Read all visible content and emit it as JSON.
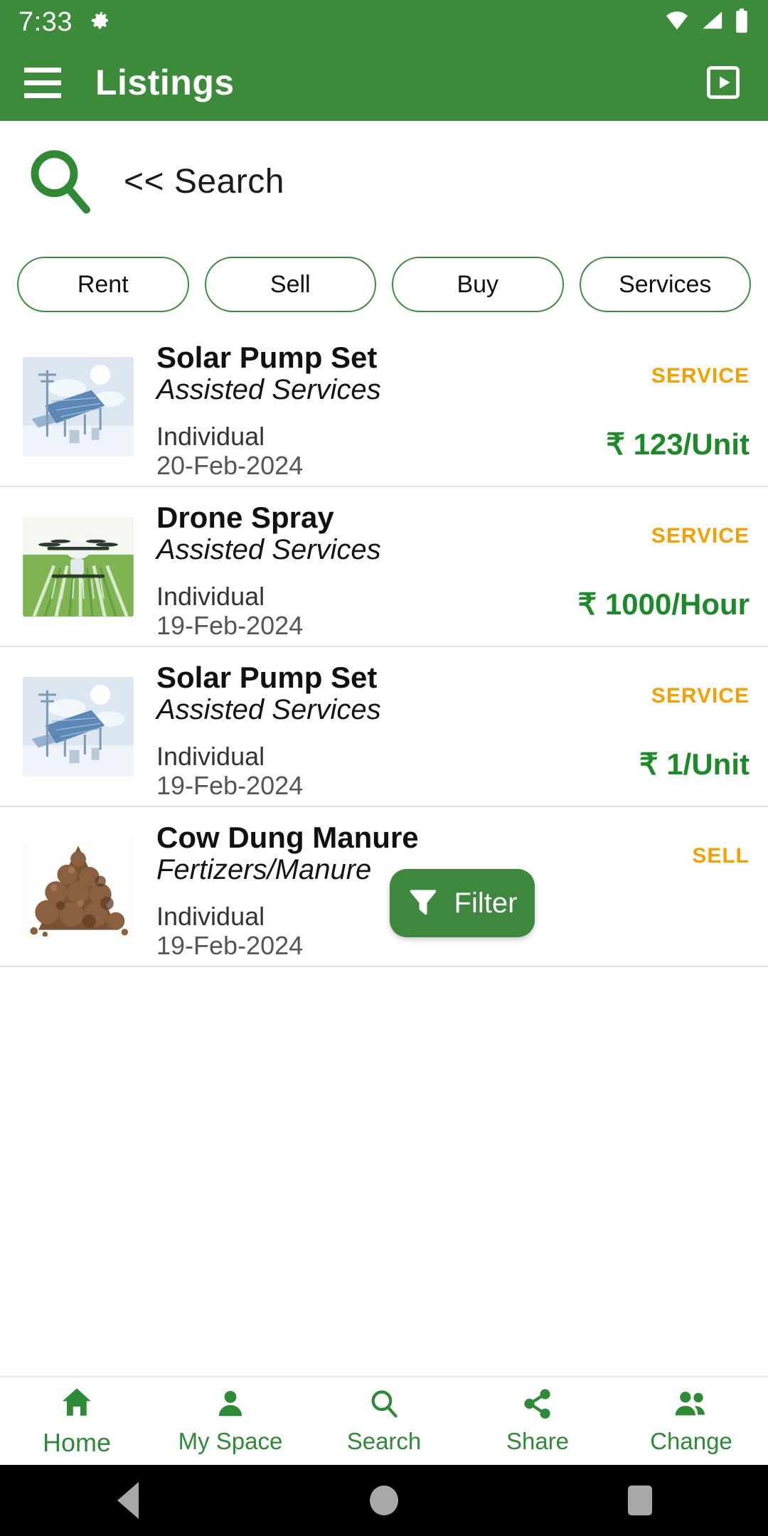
{
  "status_bar": {
    "time": "7:33",
    "gear_icon": "gear-icon",
    "wifi_icon": "wifi-icon",
    "signal_icon": "cellular-signal-icon",
    "battery_icon": "battery-icon"
  },
  "app_bar": {
    "menu_icon": "hamburger-menu-icon",
    "title": "Listings",
    "action_icon": "cast-screen-icon"
  },
  "search": {
    "icon": "search-icon",
    "label": "<< Search"
  },
  "chips": [
    {
      "label": "Rent"
    },
    {
      "label": "Sell"
    },
    {
      "label": "Buy"
    },
    {
      "label": "Services"
    }
  ],
  "listings": [
    {
      "title": "Solar Pump Set",
      "category": "Assisted Services",
      "badge": "SERVICE",
      "owner": "Individual",
      "date": "20-Feb-2024",
      "price": "₹ 123/Unit",
      "thumb": "solar-panel-thumbnail"
    },
    {
      "title": "Drone Spray",
      "category": "Assisted Services",
      "badge": "SERVICE",
      "owner": "Individual",
      "date": "19-Feb-2024",
      "price": "₹ 1000/Hour",
      "thumb": "drone-spray-thumbnail"
    },
    {
      "title": "Solar Pump Set",
      "category": "Assisted Services",
      "badge": "SERVICE",
      "owner": "Individual",
      "date": "19-Feb-2024",
      "price": "₹ 1/Unit",
      "thumb": "solar-panel-thumbnail"
    },
    {
      "title": "Cow Dung Manure",
      "category": "Fertizers/Manure",
      "badge": "SELL",
      "owner": "Individual",
      "date": "19-Feb-2024",
      "price": "",
      "thumb": "cow-dung-manure-thumbnail"
    }
  ],
  "fab": {
    "label": "Filter",
    "icon": "filter-funnel-icon"
  },
  "bottom_nav": [
    {
      "label": "Home",
      "icon": "home-icon",
      "active": true
    },
    {
      "label": "My Space",
      "icon": "person-icon",
      "active": false
    },
    {
      "label": "Search",
      "icon": "search-icon",
      "active": false
    },
    {
      "label": "Share",
      "icon": "share-icon",
      "active": false
    },
    {
      "label": "Change",
      "icon": "people-icon",
      "active": false
    }
  ],
  "system_nav": {
    "back_icon": "back-triangle-icon",
    "home_icon": "home-circle-icon",
    "recents_icon": "recents-square-icon"
  },
  "colors": {
    "brand_green": "#3b8b3b",
    "accent_orange": "#f5a000",
    "price_green": "#1c8a28",
    "nav_green": "#2d8a36"
  }
}
